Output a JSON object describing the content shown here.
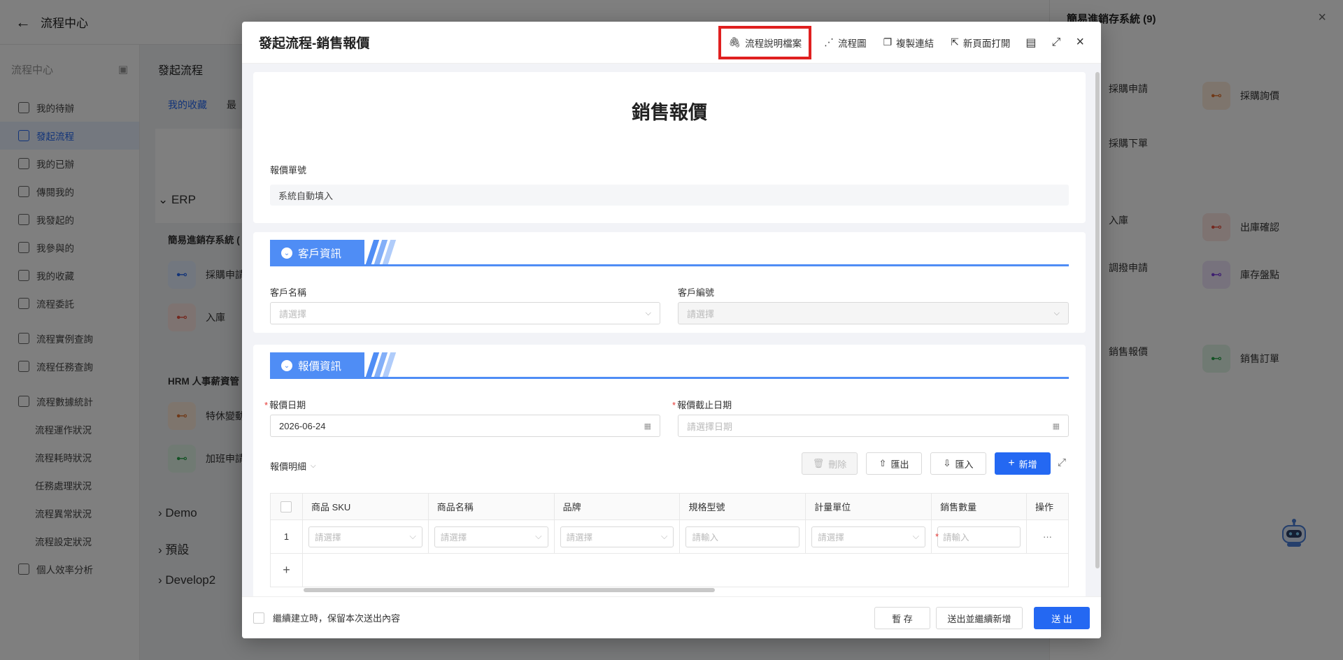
{
  "app": {
    "title": "流程中心"
  },
  "sidebar": {
    "header": "流程中心",
    "items": [
      {
        "label": "我的待辦"
      },
      {
        "label": "發起流程"
      },
      {
        "label": "我的已辦"
      },
      {
        "label": "傳閱我的"
      },
      {
        "label": "我發起的"
      },
      {
        "label": "我參與的"
      },
      {
        "label": "我的收藏"
      },
      {
        "label": "流程委託"
      },
      {
        "label": "流程實例查詢"
      },
      {
        "label": "流程任務查詢"
      },
      {
        "label": "流程數據統計"
      },
      {
        "label": "流程運作狀況"
      },
      {
        "label": "流程耗時狀況"
      },
      {
        "label": "任務處理狀況"
      },
      {
        "label": "流程異常狀況"
      },
      {
        "label": "流程設定狀況"
      },
      {
        "label": "個人效率分析"
      }
    ]
  },
  "background": {
    "page_title": "發起流程",
    "tabs": [
      "我的收藏",
      "最"
    ],
    "groups": [
      "ERP",
      "Demo",
      "預設",
      "Develop2"
    ],
    "erp_subtitle": "簡易進銷存系統 (",
    "hrm_subtitle": "HRM 人事薪資管",
    "erp_items": [
      "採購申請",
      "入庫"
    ],
    "hrm_items": [
      "特休變動",
      "加班申請"
    ]
  },
  "right_panel": {
    "title": "簡易進銷存系統 (9)",
    "items": [
      "採購申請",
      "採購詢價",
      "採購下單",
      "入庫",
      "出庫確認",
      "調撥申請",
      "庫存盤點",
      "銷售報價",
      "銷售訂單"
    ]
  },
  "modal": {
    "title": "發起流程-銷售報價",
    "actions": {
      "doc": "流程說明檔案",
      "diagram": "流程圖",
      "copy_link": "複製連結",
      "open_new": "新頁面打開"
    },
    "form_title": "銷售報價",
    "quote_no_label": "報價單號",
    "quote_no_value": "系統自動填入",
    "customer_section": "客戶資訊",
    "customer_name_label": "客戶名稱",
    "customer_name_placeholder": "請選擇",
    "customer_code_label": "客戶編號",
    "customer_code_placeholder": "請選擇",
    "quote_section": "報價資訊",
    "quote_date_label": "報價日期",
    "quote_date_value": "2026-06-24",
    "deadline_label": "報價截止日期",
    "deadline_placeholder": "請選擇日期",
    "detail_label": "報價明細",
    "buttons": {
      "delete": "刪除",
      "export": "匯出",
      "import": "匯入",
      "add": "新增"
    },
    "table": {
      "columns": [
        "商品 SKU",
        "商品名稱",
        "品牌",
        "規格型號",
        "計量單位",
        "銷售數量",
        "操作"
      ],
      "row_no": "1",
      "select_placeholder": "請選擇",
      "input_placeholder": "請輸入",
      "more": "···",
      "add_row": "+"
    },
    "footer": {
      "keep_label": "繼續建立時，保留本次送出內容",
      "save": "暫 存",
      "submit_continue": "送出並繼續新增",
      "submit": "送 出"
    }
  }
}
